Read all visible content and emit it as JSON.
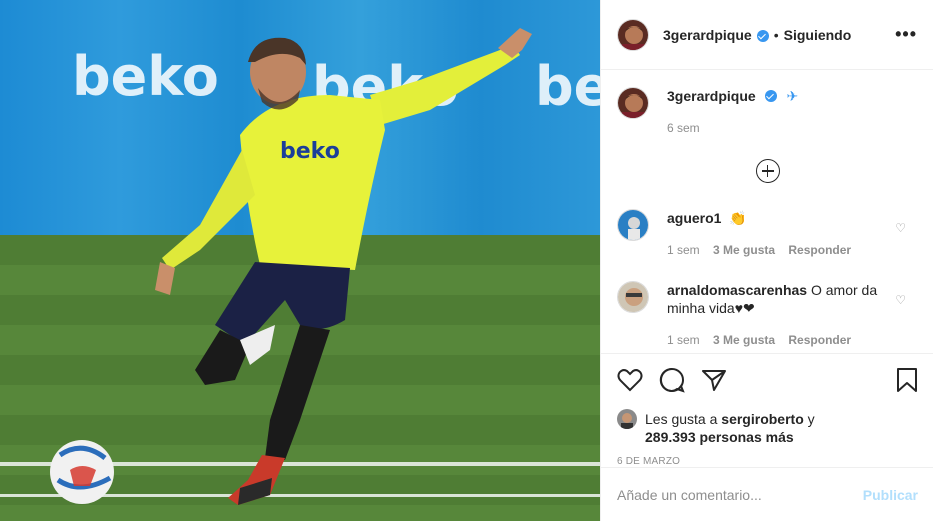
{
  "post": {
    "username": "3gerardpique",
    "follow_status": "Siguiendo",
    "separator": "•",
    "more_label": "•••"
  },
  "caption": {
    "username": "3gerardpique",
    "emoji": "✈",
    "time": "6 sem"
  },
  "comments": [
    {
      "username": "aguero1",
      "text": "👏",
      "time": "1 sem",
      "likes": "3 Me gusta",
      "reply": "Responder"
    },
    {
      "username": "arnaldomascarenhas",
      "text": "O amor da minha vida♥❤",
      "time": "1 sem",
      "likes": "3 Me gusta",
      "reply": "Responder"
    }
  ],
  "likes_summary": {
    "prefix": "Les gusta a",
    "user": "sergiroberto",
    "conj": "y",
    "count": "289.393 personas más"
  },
  "date": "6 DE MARZO",
  "comment_box": {
    "placeholder": "Añade un comentario...",
    "publish": "Publicar"
  },
  "photo": {
    "board_text": "beko"
  },
  "colors": {
    "verified": "#3897f0",
    "publish_disabled": "#b2dffc",
    "jersey": "#e7f23a",
    "shorts": "#1b2145"
  }
}
